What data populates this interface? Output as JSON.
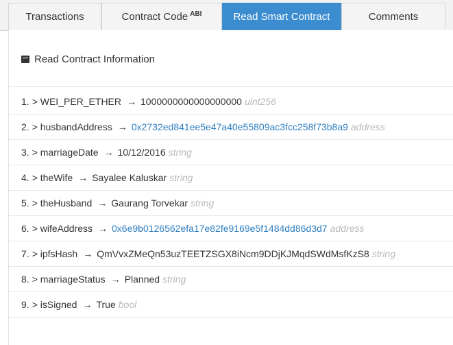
{
  "tabs": [
    {
      "label": "Transactions"
    },
    {
      "label": "Contract Code",
      "sup": "ABI"
    },
    {
      "label": "Read Smart Contract"
    },
    {
      "label": "Comments"
    }
  ],
  "panel": {
    "title": "Read Contract Information",
    "icon": "book-icon"
  },
  "rows": [
    {
      "index": "1.",
      "name": "> WEI_PER_ETHER",
      "arrow": "→",
      "value": "1000000000000000000",
      "type": "uint256",
      "link": false
    },
    {
      "index": "2.",
      "name": "> husbandAddress",
      "arrow": "→",
      "value": "0x2732ed841ee5e47a40e55809ac3fcc258f73b8a9",
      "type": "address",
      "link": true
    },
    {
      "index": "3.",
      "name": "> marriageDate",
      "arrow": "→",
      "value": "10/12/2016",
      "type": "string",
      "link": false
    },
    {
      "index": "4.",
      "name": "> theWife",
      "arrow": "→",
      "value": "Sayalee Kaluskar",
      "type": "string",
      "link": false
    },
    {
      "index": "5.",
      "name": "> theHusband",
      "arrow": "→",
      "value": "Gaurang Torvekar",
      "type": "string",
      "link": false
    },
    {
      "index": "6.",
      "name": "> wifeAddress",
      "arrow": "→",
      "value": "0x6e9b0126562efa17e82fe9169e5f1484dd86d3d7",
      "type": "address",
      "link": true
    },
    {
      "index": "7.",
      "name": "> ipfsHash",
      "arrow": "→",
      "value": "QmVvxZMeQn53uzTEETZSGX8iNcm9DDjKJMqdSWdMsfKzS8",
      "type": "string",
      "link": false
    },
    {
      "index": "8.",
      "name": "> marriageStatus",
      "arrow": "→",
      "value": "Planned",
      "type": "string",
      "link": false
    },
    {
      "index": "9.",
      "name": "> isSigned",
      "arrow": "→",
      "value": "True",
      "type": "bool",
      "link": false
    }
  ],
  "colors": {
    "accent": "#3b8dd0",
    "link": "#2f7fc1",
    "type_hint": "#b8b8b8"
  }
}
